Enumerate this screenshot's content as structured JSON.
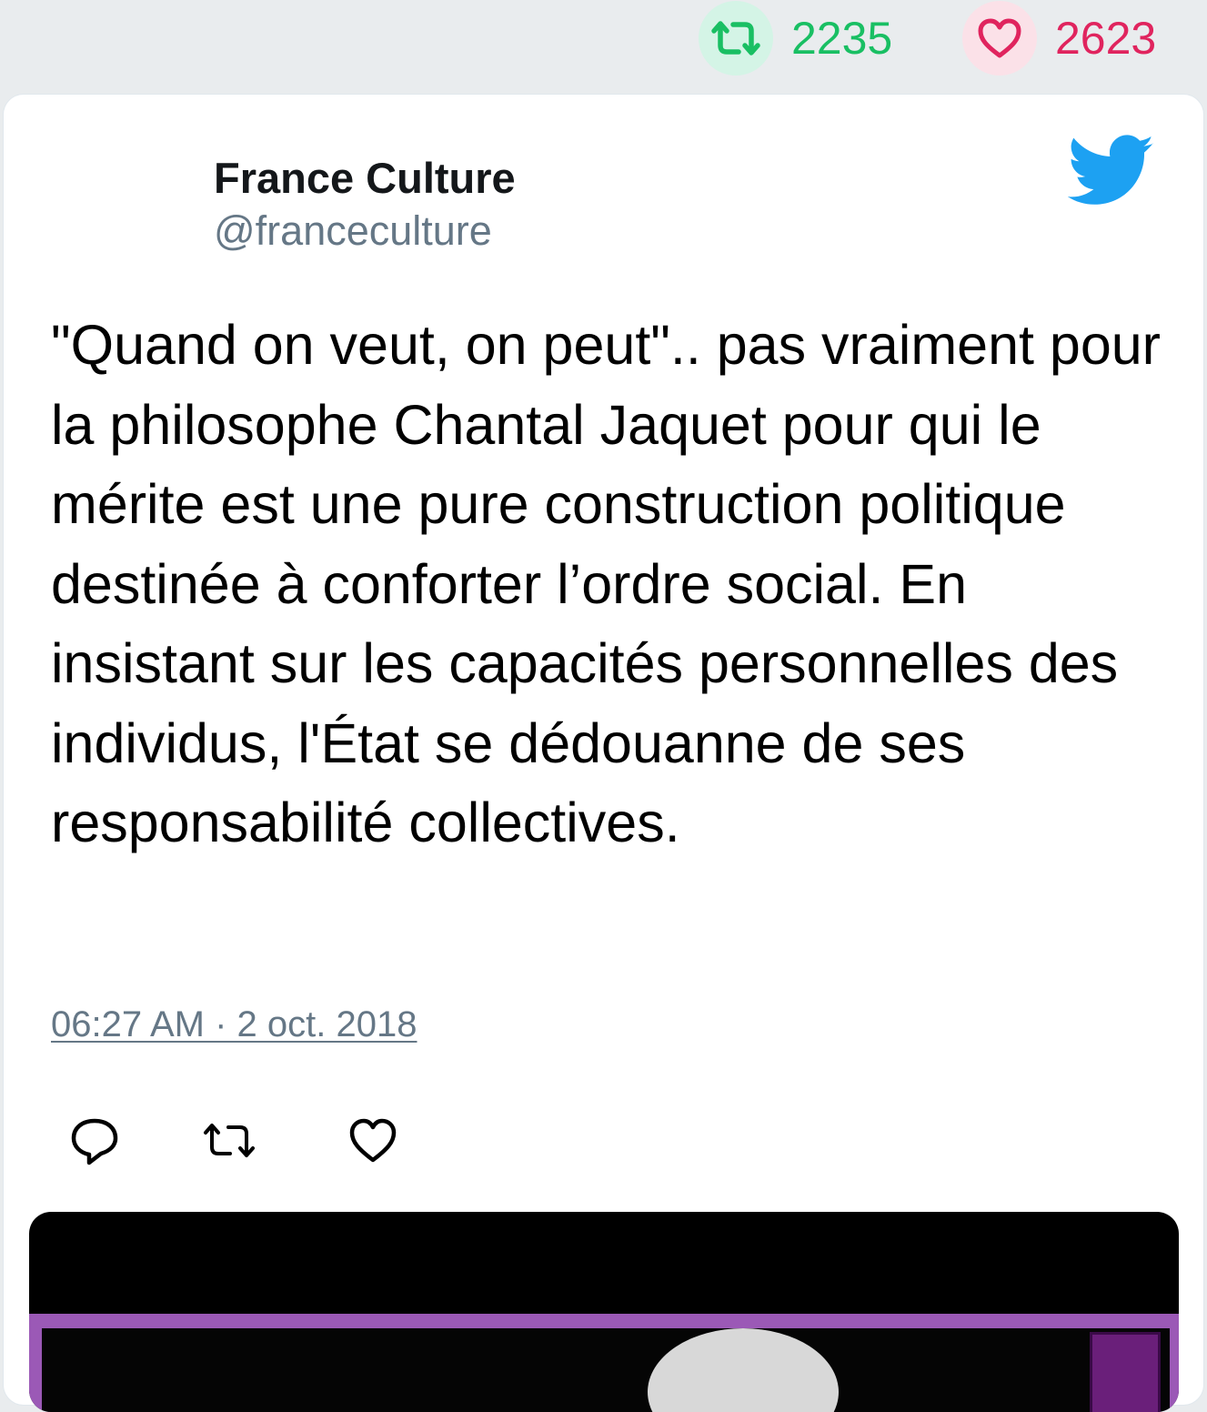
{
  "stats": {
    "retweet_count": "2235",
    "like_count": "2623",
    "retweet_icon": "retweet-icon",
    "like_icon": "heart-icon"
  },
  "tweet": {
    "author_name": "France Culture",
    "author_handle": "@franceculture",
    "text": "\"Quand on veut, on peut\".. pas vraiment pour la philosophe Chantal Jaquet pour qui le mérite est une pure construction politique destinée à conforter l’ordre social. En insistant sur les capacités personnelles des individus, l'État se dédouanne de ses responsabilité collectives.",
    "timestamp": "06:27 AM · 2 oct. 2018",
    "brand_icon": "twitter-bird-icon"
  },
  "actions": {
    "reply_icon": "reply-icon",
    "retweet_icon": "retweet-icon",
    "like_icon": "heart-icon"
  },
  "colors": {
    "retweet_green": "#19bf63",
    "like_red": "#e0245e",
    "twitter_blue": "#1da1f2",
    "handle_gray": "#657786",
    "media_purple": "#9b59b6"
  }
}
